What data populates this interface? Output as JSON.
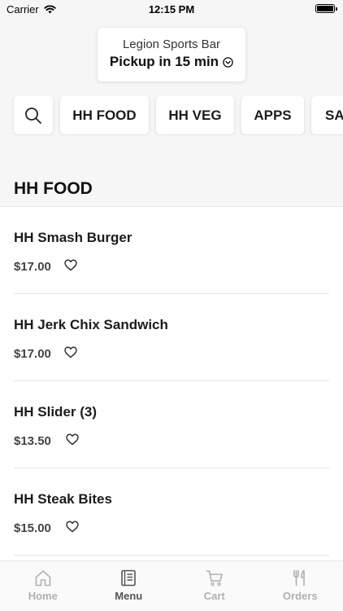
{
  "status": {
    "carrier": "Carrier",
    "time": "12:15 PM"
  },
  "pickup": {
    "store": "Legion Sports Bar",
    "time_text": "Pickup in 15 min"
  },
  "categories": [
    "HH FOOD",
    "HH VEG",
    "APPS",
    "SA"
  ],
  "section_title": "HH FOOD",
  "items": [
    {
      "name": "HH Smash Burger",
      "price": "$17.00"
    },
    {
      "name": "HH Jerk Chix Sandwich",
      "price": "$17.00"
    },
    {
      "name": "HH Slider (3)",
      "price": "$13.50"
    },
    {
      "name": "HH Steak Bites",
      "price": "$15.00"
    }
  ],
  "tabs": [
    {
      "label": "Home",
      "icon": "home-icon",
      "active": false
    },
    {
      "label": "Menu",
      "icon": "menu-book-icon",
      "active": true
    },
    {
      "label": "Cart",
      "icon": "cart-icon",
      "active": false
    },
    {
      "label": "Orders",
      "icon": "fork-knife-icon",
      "active": false
    }
  ]
}
